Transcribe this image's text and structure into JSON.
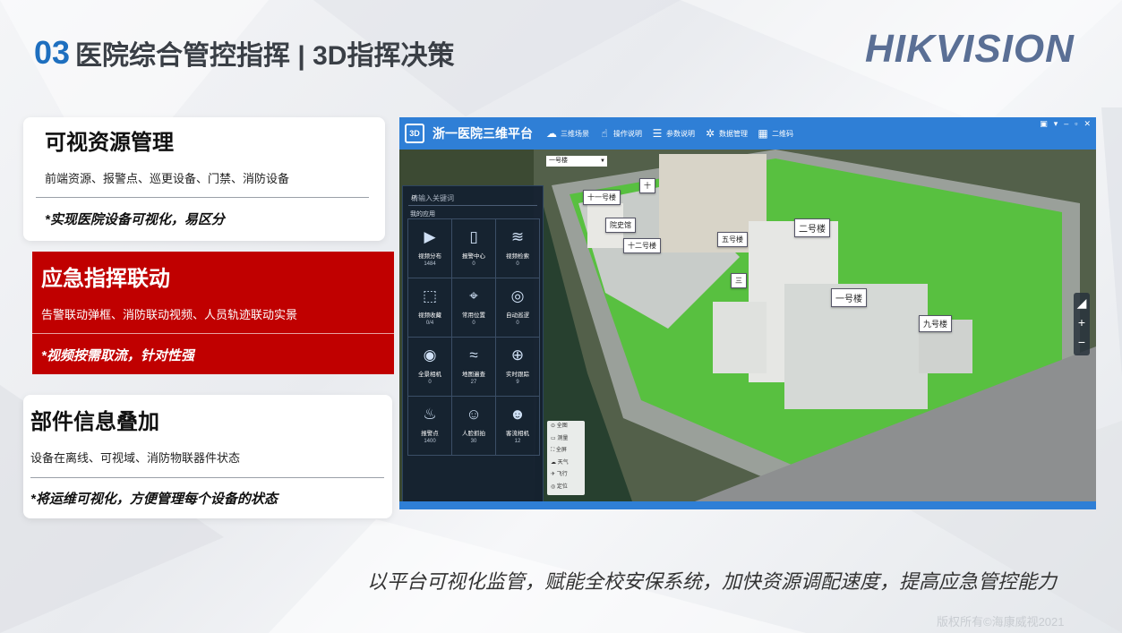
{
  "slide": {
    "number": "03",
    "title": "医院综合管控指挥 | 3D指挥决策",
    "logo": "HIKVISION",
    "slogan": "以平台可视化监管，赋能全校安保系统，加快资源调配速度，提高应急管控能力",
    "copyright": "版权所有©海康威视2021"
  },
  "cards": [
    {
      "heading": "可视资源管理",
      "desc": "前端资源、报警点、巡更设备、门禁、消防设备",
      "summary": "*实现医院设备可视化，易区分"
    },
    {
      "heading": "应急指挥联动",
      "desc": "告警联动弹框、消防联动视频、人员轨迹联动实景",
      "summary": "*视频按需取流，针对性强"
    },
    {
      "heading": "部件信息叠加",
      "desc": "设备在离线、可视域、消防物联器件状态",
      "summary": "*将运维可视化，方便管理每个设备的状态"
    }
  ],
  "app": {
    "badge": "3D",
    "title": "浙一医院三维平台",
    "menu": [
      {
        "icon": "cloud-icon",
        "label": "三维场景"
      },
      {
        "icon": "hand-icon",
        "label": "操作说明"
      },
      {
        "icon": "sliders-icon",
        "label": "参数说明"
      },
      {
        "icon": "network-icon",
        "label": "数据管理"
      },
      {
        "icon": "qrcode-icon",
        "label": "二维码"
      }
    ],
    "search_placeholder": "请输入关键词",
    "my_apps_label": "我的应用",
    "floor_select": "一号楼",
    "apps": [
      {
        "icon": "video-distribution-icon",
        "glyph": "▶",
        "label": "视频分布",
        "count": "1484"
      },
      {
        "icon": "alarm-center-icon",
        "glyph": "▯",
        "label": "报警中心",
        "count": "0"
      },
      {
        "icon": "video-search-icon",
        "glyph": "≋",
        "label": "视频检索",
        "count": "0"
      },
      {
        "icon": "video-favorites-icon",
        "glyph": "⬚",
        "label": "视频收藏",
        "count": "0/4"
      },
      {
        "icon": "common-location-icon",
        "glyph": "⌖",
        "label": "常用位置",
        "count": "0"
      },
      {
        "icon": "auto-patrol-icon",
        "glyph": "◎",
        "label": "自动巡逻",
        "count": "0"
      },
      {
        "icon": "panorama-camera-icon",
        "glyph": "◉",
        "label": "全景相机",
        "count": "0"
      },
      {
        "icon": "map-track-icon",
        "glyph": "≈",
        "label": "地图遍查",
        "count": "27"
      },
      {
        "icon": "realtime-track-icon",
        "glyph": "⊕",
        "label": "实时跟踪",
        "count": "9"
      },
      {
        "icon": "alarm-point-icon",
        "glyph": "♨",
        "label": "报警点",
        "count": "1400"
      },
      {
        "icon": "face-capture-icon",
        "glyph": "☺",
        "label": "人脸抓拍",
        "count": "30"
      },
      {
        "icon": "passenger-camera-icon",
        "glyph": "☻",
        "label": "客流相机",
        "count": "12"
      }
    ],
    "tools": [
      "全图",
      "测量",
      "全屏",
      "天气",
      "飞行",
      "定位"
    ],
    "building_labels": [
      "十一号楼",
      "十",
      "院史馆",
      "十二号楼",
      "五号楼",
      "二号楼",
      "三",
      "一号楼",
      "九号楼"
    ],
    "zoom": [
      "◢",
      "+",
      "−"
    ],
    "window_controls": [
      "▣",
      "▾",
      "–",
      "▫",
      "✕"
    ]
  }
}
